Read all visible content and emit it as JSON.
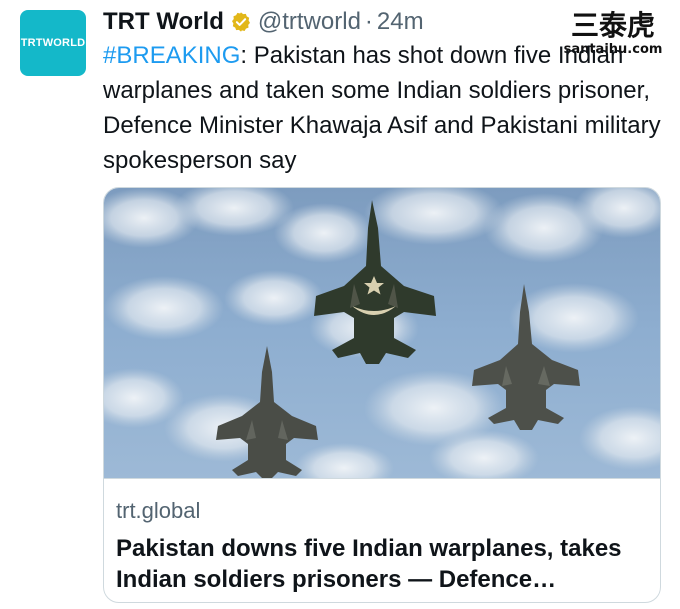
{
  "account": {
    "avatar_text": "TRTWORLD",
    "display_name": "TRT World",
    "handle": "@trtworld",
    "separator": "·",
    "timestamp": "24m",
    "verified_badge_color": "#e2b719",
    "avatar_color": "#14b8c9"
  },
  "watermark": {
    "chinese": "三泰虎",
    "url": "santaihu.com"
  },
  "tweet": {
    "hashtag": "#BREAKING",
    "body": ": Pakistan has shot down five Indian warplanes and taken some Indian soldiers prisoner, Defence Minister Khawaja Asif and Pakistani military spokesperson say"
  },
  "link_card": {
    "image_alt": "jets",
    "domain": "trt.global",
    "title": "Pakistan downs five Indian warplanes, takes Indian soldiers prisoners — Defence…"
  },
  "colors": {
    "link": "#1d9bf0",
    "secondary_text": "#536471",
    "primary_text": "#0f1419",
    "border": "#cfd9de"
  }
}
